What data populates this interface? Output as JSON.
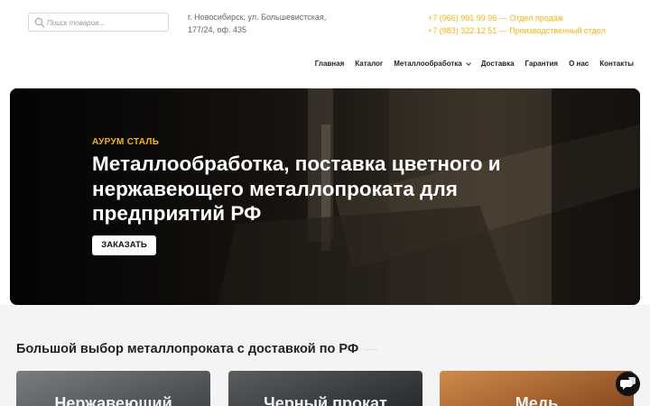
{
  "search": {
    "placeholder": "Поиск товаров..."
  },
  "address": {
    "line1": "г. Новосибирск, ул. Большевистская,",
    "line2": "177/24, оф. 435"
  },
  "phones": [
    "+7 (966) 991 99 96 — Отдел продаж",
    "+7 (983) 322 12 51 — Производственный отдел"
  ],
  "nav": [
    {
      "label": "Главная"
    },
    {
      "label": "Каталог"
    },
    {
      "label": "Металлообработка"
    },
    {
      "label": "Доставка"
    },
    {
      "label": "Гарантия"
    },
    {
      "label": "О нас"
    },
    {
      "label": "Контакты"
    }
  ],
  "hero": {
    "kicker": "АУРУМ СТАЛЬ",
    "title": "Металлообработка, поставка цветного и нержавеющего металлопроката для предприятий РФ",
    "button": "ЗАКАЗАТЬ"
  },
  "section": {
    "title": "Большой выбор металлопроката с доставкой по РФ",
    "cards": [
      {
        "label": "Нержавеющий"
      },
      {
        "label": "Черный прокат"
      },
      {
        "label": "Медь"
      }
    ]
  },
  "colors": {
    "accent": "#f2b70a"
  },
  "icons": {
    "search": "search-icon",
    "chevron": "chevron-down-icon",
    "chat": "chat-icon"
  }
}
